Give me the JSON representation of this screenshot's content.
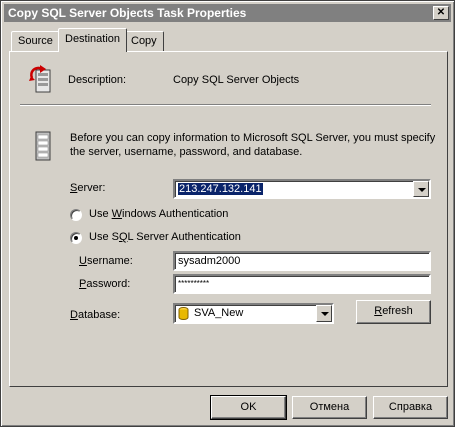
{
  "window": {
    "title": "Copy SQL Server Objects Task Properties",
    "close_glyph": "✕"
  },
  "tabs": [
    {
      "label": "Source",
      "active": false
    },
    {
      "label": "Destination",
      "active": true
    },
    {
      "label": "Copy",
      "active": false
    }
  ],
  "description": {
    "label": "Description:",
    "value": "Copy SQL Server Objects",
    "icon": "copy-objects-icon"
  },
  "info": {
    "text_line1": "Before you can copy information to Microsoft SQL Server, you must specify",
    "text_line2": "the server, username, password, and database.",
    "icon": "database-server-icon"
  },
  "server": {
    "label": "Server:",
    "value": "213.247.132.141"
  },
  "auth": {
    "windows_label": "Use Windows Authentication",
    "sql_label": "Use SQL Server Authentication",
    "selected": "sql"
  },
  "username": {
    "label": "Username:",
    "value": "sysadm2000"
  },
  "password": {
    "label": "Password:",
    "value": "**********"
  },
  "database": {
    "label": "Database:",
    "value": "SVA_New",
    "refresh_label": "Refresh",
    "icon": "database-icon"
  },
  "footer": {
    "ok_label": "OK",
    "cancel_label": "Отмена",
    "help_label": "Справка"
  }
}
